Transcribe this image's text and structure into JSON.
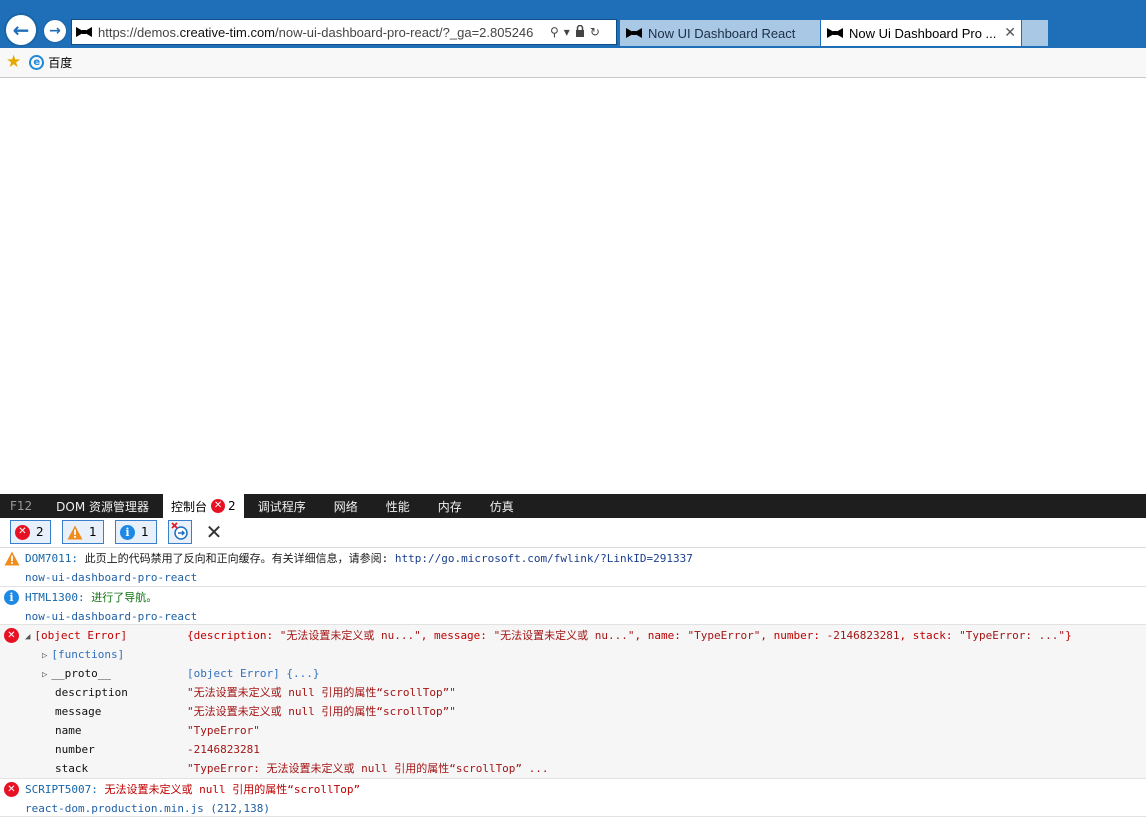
{
  "browser": {
    "url_prefix": "https://demos.",
    "url_host": "creative-tim.com",
    "url_path": "/now-ui-dashboard-pro-react/?_ga=2.805246",
    "tabs": [
      {
        "label": "Now UI Dashboard React"
      },
      {
        "label": "Now Ui Dashboard Pro ..."
      }
    ],
    "favorites": [
      {
        "label": "百度"
      }
    ]
  },
  "devtools": {
    "tabs": [
      "F12",
      "DOM 资源管理器",
      "控制台",
      "调试程序",
      "网络",
      "性能",
      "内存",
      "仿真"
    ],
    "console_error_count": "2",
    "filters": {
      "errors": "2",
      "warnings": "1",
      "info": "1"
    }
  },
  "console": {
    "warning": {
      "code": "DOM7011:",
      "text": "此页上的代码禁用了反向和正向缓存。有关详细信息，请参阅:",
      "link": "http://go.microsoft.com/fwlink/?LinkID=291337",
      "source": "now-ui-dashboard-pro-react"
    },
    "info": {
      "code": "HTML1300:",
      "text": "进行了导航。",
      "source": "now-ui-dashboard-pro-react"
    },
    "error_object": {
      "label": "[object Error]",
      "summary_open": "{description: ",
      "summary_desc": "\"无法设置未定义或 nu...\"",
      "summary_msg_key": ", message: ",
      "summary_msg": "\"无法设置未定义或 nu...\"",
      "summary_name_key": ", name: ",
      "summary_name": "\"TypeError\"",
      "summary_number_key": ", number: ",
      "summary_number": "-2146823281",
      "summary_stack_key": ", stack: ",
      "summary_stack": "\"TypeError: ...\"",
      "summary_close": "}",
      "functions": "[functions]",
      "proto_key": "__proto__",
      "proto_val": "[object Error] {...}",
      "props": [
        {
          "key": "description",
          "value": "\"无法设置未定义或 null 引用的属性“scrollTop”\""
        },
        {
          "key": "message",
          "value": "\"无法设置未定义或 null 引用的属性“scrollTop”\""
        },
        {
          "key": "name",
          "value": "\"TypeError\""
        },
        {
          "key": "number",
          "value": "-2146823281"
        },
        {
          "key": "stack",
          "value": "\"TypeError: 无法设置未定义或 null 引用的属性“scrollTop” ..."
        }
      ]
    },
    "script_error": {
      "code": "SCRIPT5007:",
      "text": "无法设置未定义或 null 引用的属性“scrollTop”",
      "source": "react-dom.production.min.js (212,138)"
    }
  }
}
